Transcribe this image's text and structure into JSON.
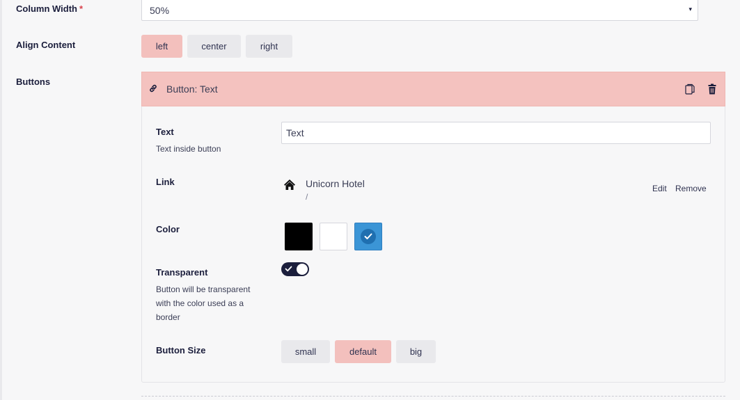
{
  "column_width": {
    "label": "Column Width",
    "required_mark": "*",
    "value": "50%",
    "caret": "▾"
  },
  "align_content": {
    "label": "Align Content",
    "options": [
      "left",
      "center",
      "right"
    ],
    "selected": "left"
  },
  "buttons": {
    "label": "Buttons",
    "block": {
      "title": "Button: Text",
      "text_field": {
        "label": "Text",
        "help": "Text inside button",
        "value": "Text"
      },
      "link_field": {
        "label": "Link",
        "page_title": "Unicorn Hotel",
        "page_path": "/",
        "edit_label": "Edit",
        "remove_label": "Remove"
      },
      "color_field": {
        "label": "Color",
        "options": [
          "#000000",
          "#ffffff",
          "#3b95d6"
        ],
        "selected": "#3b95d6"
      },
      "transparent_field": {
        "label": "Transparent",
        "help_lines": [
          "Button will be transparent",
          "with the color used as a",
          "border"
        ],
        "enabled": true
      },
      "size_field": {
        "label": "Button Size",
        "options": [
          "small",
          "default",
          "big"
        ],
        "selected": "default"
      }
    }
  },
  "colors": {
    "accent_active": "#f3c0bd",
    "segment_bg": "#e9e9ec",
    "text_dark": "#1b1e3c"
  }
}
